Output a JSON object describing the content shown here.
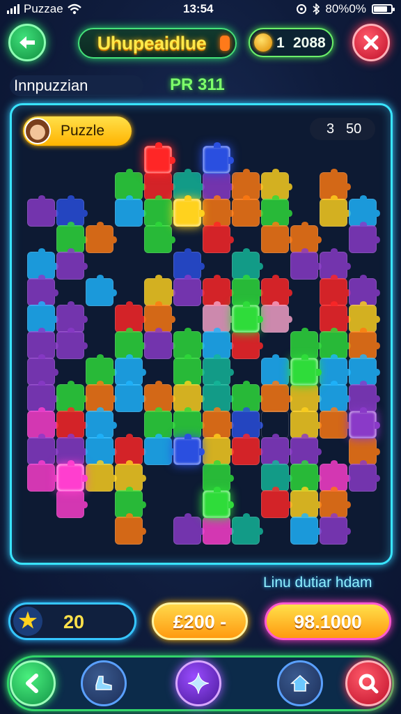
{
  "status_bar": {
    "carrier": "Puzzae",
    "time": "13:54",
    "battery_text": "80%0%",
    "battery_level": 0.8,
    "icons": [
      "signal-icon",
      "wifi-icon",
      "at-icon",
      "bluetooth-icon",
      "battery-icon"
    ]
  },
  "header": {
    "title": "Uhupeaidlue",
    "coin_count_a": "1",
    "coin_count_b": "2088",
    "back_icon": "back-arrow-icon",
    "close_icon": "close-icon"
  },
  "subheader": {
    "label": "Innpuzzian",
    "pr_text": "PR 311"
  },
  "board": {
    "badge_label": "Puzzle",
    "score_a": "3",
    "score_b": "50",
    "tile_colors": {
      "r": "#ff2626",
      "o": "#ff7a12",
      "y": "#ffd21e",
      "g": "#2fdc3a",
      "l": "#1fb6ff",
      "b": "#2a4fe0",
      "p": "#8a3ac8",
      "m": "#ff3ecf",
      "t": "#14b89a",
      "k": "#f6a2c8"
    }
  },
  "hint_text": "Linu dutiar hdam",
  "stats": {
    "stars_value": "20",
    "middle_value": "£200 -",
    "right_value": "98.1000"
  },
  "bottom_nav": {
    "icons": [
      "back-arrow-icon",
      "boot-icon",
      "sparkle-icon",
      "home-icon",
      "search-icon"
    ]
  }
}
